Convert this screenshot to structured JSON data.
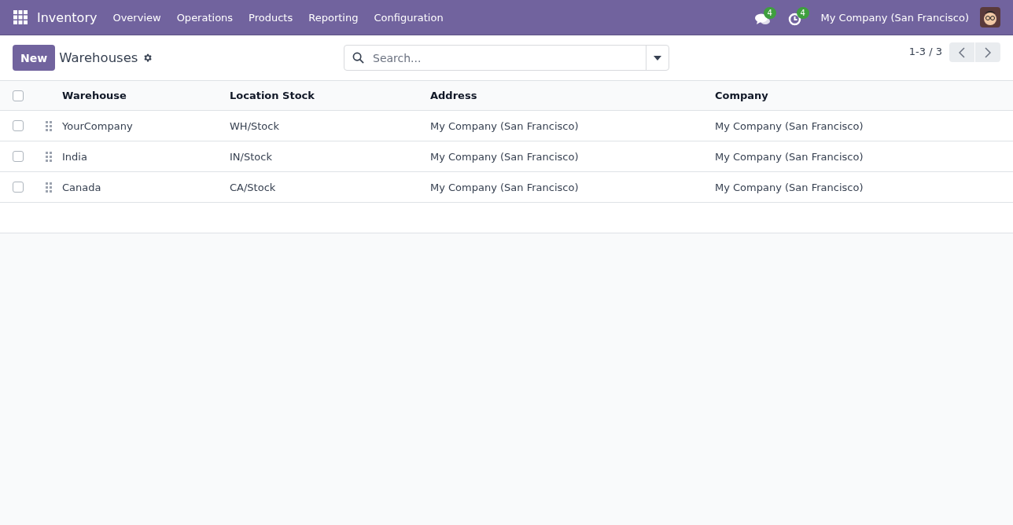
{
  "navbar": {
    "app_name": "Inventory",
    "menu": [
      "Overview",
      "Operations",
      "Products",
      "Reporting",
      "Configuration"
    ],
    "messages_badge": "4",
    "activities_badge": "4",
    "company": "My Company (San Francisco)"
  },
  "control_panel": {
    "new_button": "New",
    "title": "Warehouses",
    "search": {
      "placeholder": "Search..."
    },
    "pager": "1-3 / 3"
  },
  "table": {
    "select_all_checked": false,
    "columns": [
      "Warehouse",
      "Location Stock",
      "Address",
      "Company"
    ],
    "rows": [
      {
        "selected": false,
        "cells": [
          "YourCompany",
          "WH/Stock",
          "My Company (San Francisco)",
          "My Company (San Francisco)"
        ]
      },
      {
        "selected": false,
        "cells": [
          "India",
          "IN/Stock",
          "My Company (San Francisco)",
          "My Company (San Francisco)"
        ]
      },
      {
        "selected": false,
        "cells": [
          "Canada",
          "CA/Stock",
          "My Company (San Francisco)",
          "My Company (San Francisco)"
        ]
      }
    ]
  }
}
